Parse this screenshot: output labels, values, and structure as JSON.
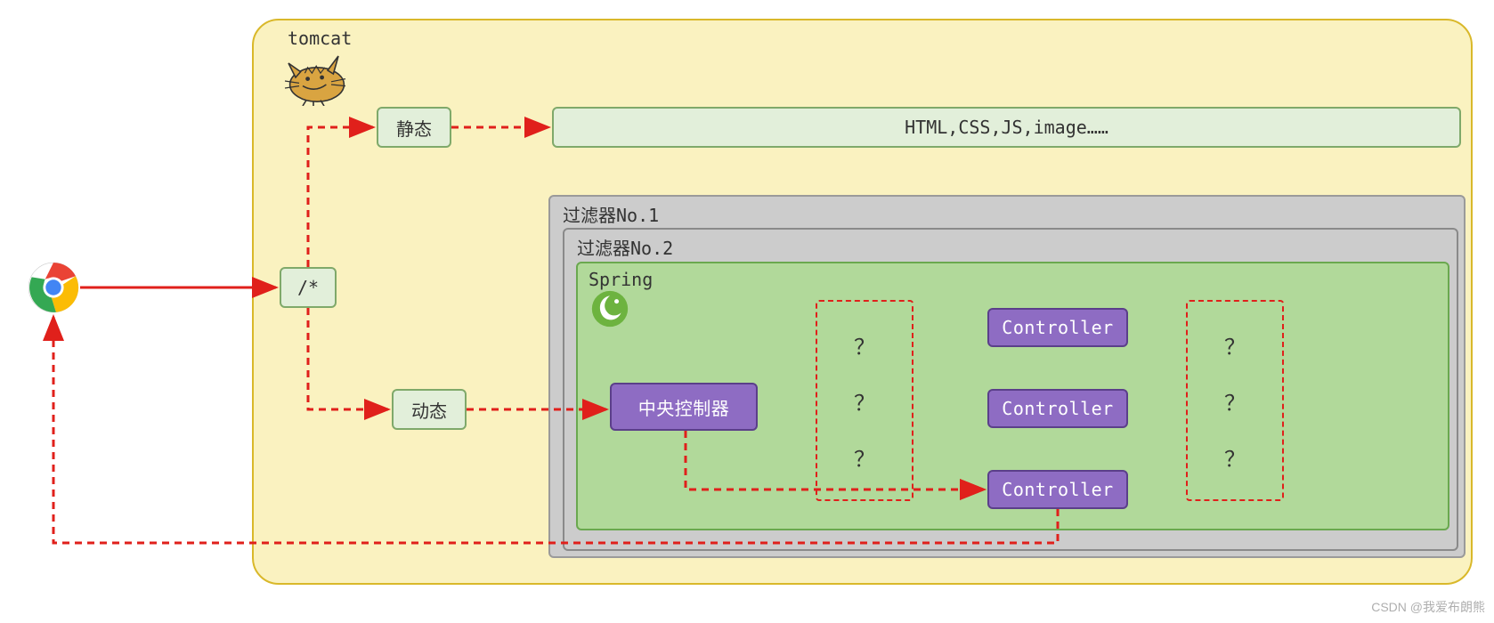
{
  "tomcat": {
    "label": "tomcat"
  },
  "filter1": {
    "label": "过滤器No.1"
  },
  "filter2": {
    "label": "过滤器No.2"
  },
  "spring": {
    "label": "Spring"
  },
  "nodes": {
    "wildcard": "/*",
    "static": "静态",
    "dynamic": "动态",
    "static_assets": "HTML,CSS,JS,image……",
    "central": "中央控制器",
    "controller": "Controller"
  },
  "qmark": "？",
  "watermark": "CSDN @我爱布朗熊"
}
